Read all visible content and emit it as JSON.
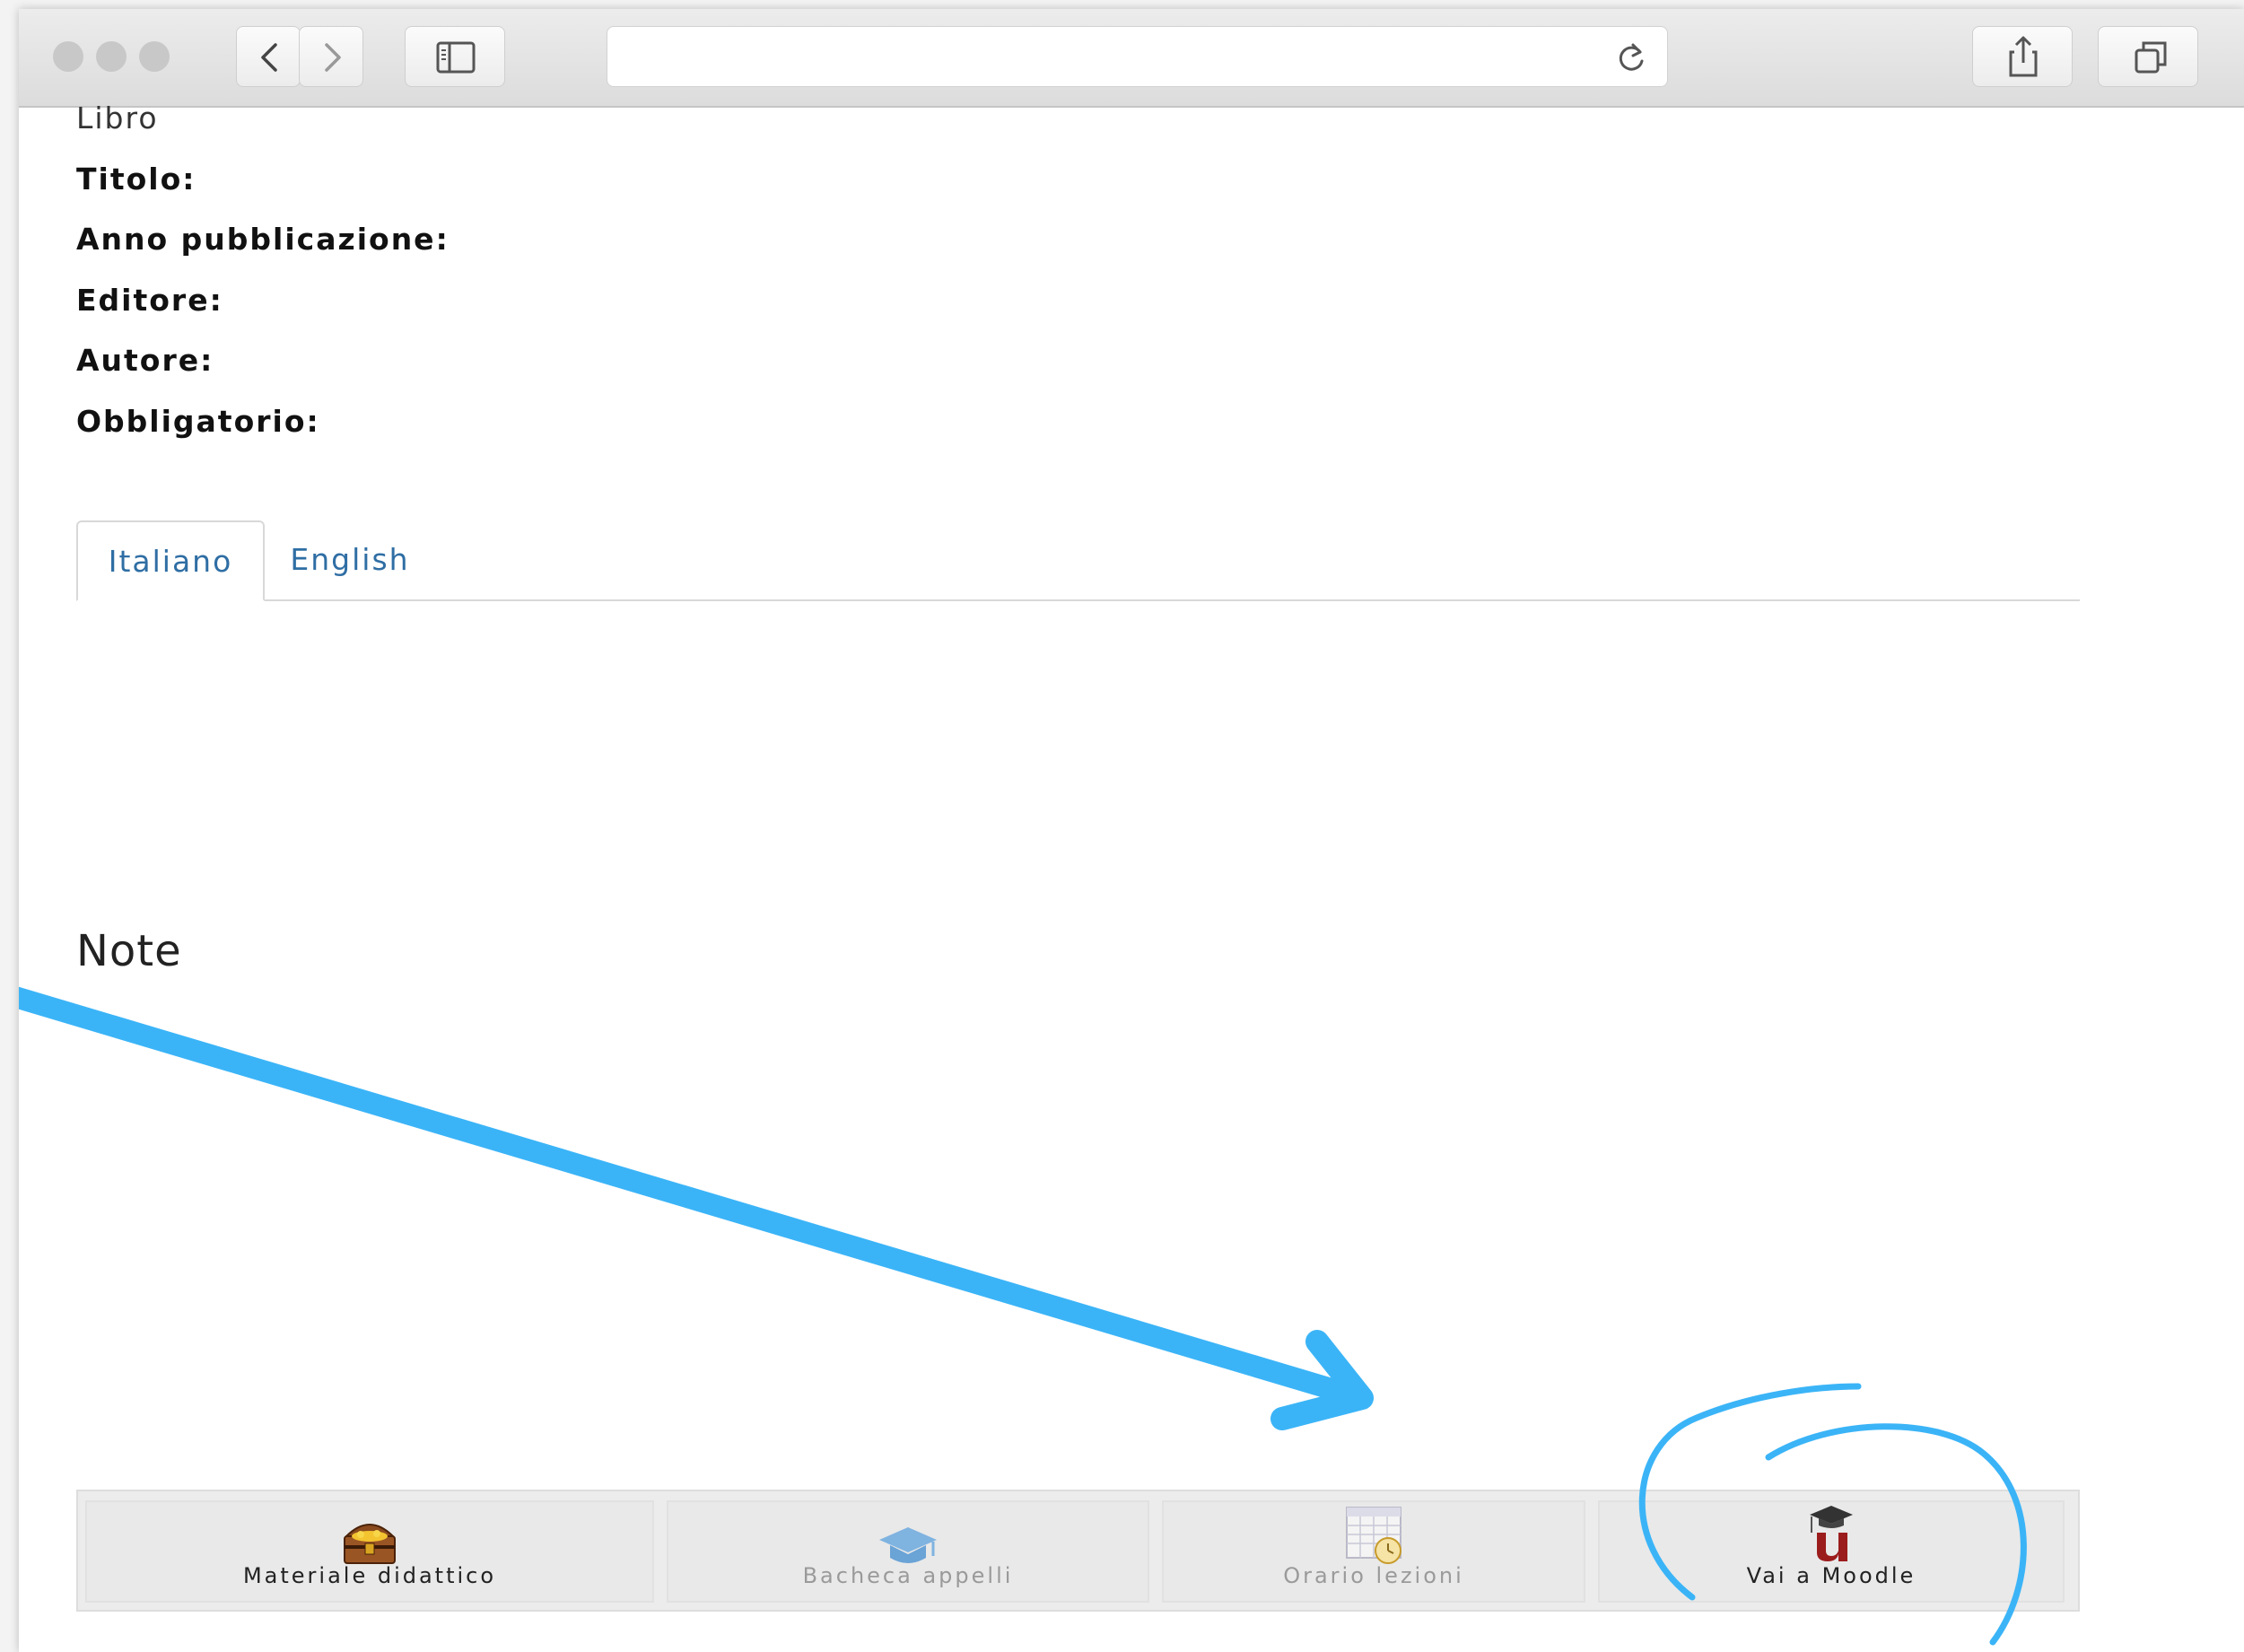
{
  "browser": {
    "icons": {
      "back": "chevron-left-icon",
      "forward": "chevron-right-icon",
      "sidebar": "sidebar-icon",
      "reload": "reload-icon",
      "share": "share-icon",
      "tabs": "tabs-overview-icon"
    }
  },
  "book": {
    "section_label": "Libro",
    "fields": {
      "title": "Titolo:",
      "year": "Anno pubblicazione:",
      "publisher": "Editore:",
      "author": "Autore:",
      "mandatory": "Obbligatorio:"
    }
  },
  "tabs": [
    {
      "label": "Italiano",
      "active": true
    },
    {
      "label": "English",
      "active": false
    }
  ],
  "notes": {
    "heading": "Note"
  },
  "bottom_bar": [
    {
      "label": "Materiale didattico",
      "icon": "treasure-chest-icon",
      "enabled": true
    },
    {
      "label": "Bacheca appelli",
      "icon": "graduation-cap-icon",
      "enabled": false
    },
    {
      "label": "Orario lezioni",
      "icon": "calendar-clock-icon",
      "enabled": false
    },
    {
      "label": "Vai a Moodle",
      "icon": "moodle-logo-icon",
      "enabled": true
    }
  ],
  "annotation": {
    "color": "#3bb4f7"
  }
}
